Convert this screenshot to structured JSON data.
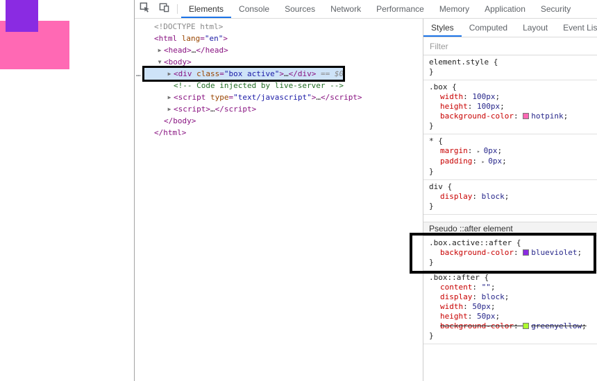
{
  "preview": {
    "hotpink": "#ff69b4",
    "blueviolet": "#8a2be2"
  },
  "toolbar": {
    "tabs": [
      "Elements",
      "Console",
      "Sources",
      "Network",
      "Performance",
      "Memory",
      "Application",
      "Security"
    ],
    "active_tab": "Elements"
  },
  "elements": {
    "more_indicator": "…",
    "lines": [
      {
        "indent": 0,
        "arrow": "",
        "segs": [
          [
            "doctype",
            "<!DOCTYPE html>"
          ]
        ]
      },
      {
        "indent": 0,
        "arrow": "",
        "segs": [
          [
            "tag",
            "<html "
          ],
          [
            "attr",
            "lang"
          ],
          [
            "tag",
            "="
          ],
          [
            "val",
            "\"en\""
          ],
          [
            "tag",
            ">"
          ]
        ]
      },
      {
        "indent": 1,
        "arrow": "▶",
        "segs": [
          [
            "tag",
            "<head>"
          ],
          [
            "ell",
            "…"
          ],
          [
            "tag",
            "</head>"
          ]
        ]
      },
      {
        "indent": 1,
        "arrow": "▼",
        "segs": [
          [
            "tag",
            "<body>"
          ]
        ]
      },
      {
        "indent": 2,
        "arrow": "▶",
        "selected": true,
        "segs": [
          [
            "tag",
            "<div "
          ],
          [
            "attr",
            "class"
          ],
          [
            "tag",
            "="
          ],
          [
            "val",
            "\"box active\""
          ],
          [
            "tag",
            ">"
          ],
          [
            "ell",
            "…"
          ],
          [
            "tag",
            "</div>"
          ],
          [
            "hint",
            " == $0"
          ]
        ]
      },
      {
        "indent": 2,
        "arrow": "",
        "segs": [
          [
            "comment",
            "<!-- Code injected by live-server -->"
          ]
        ]
      },
      {
        "indent": 2,
        "arrow": "▶",
        "segs": [
          [
            "tag",
            "<script "
          ],
          [
            "attr",
            "type"
          ],
          [
            "tag",
            "="
          ],
          [
            "val",
            "\"text/javascript\""
          ],
          [
            "tag",
            ">"
          ],
          [
            "ell",
            "…"
          ],
          [
            "tag",
            "</script>"
          ]
        ]
      },
      {
        "indent": 2,
        "arrow": "▶",
        "segs": [
          [
            "tag",
            "<script>"
          ],
          [
            "ell",
            "…"
          ],
          [
            "tag",
            "</script>"
          ]
        ]
      },
      {
        "indent": 1,
        "arrow": "",
        "segs": [
          [
            "tag",
            "</body>"
          ]
        ]
      },
      {
        "indent": 0,
        "arrow": "",
        "segs": [
          [
            "tag",
            "</html>"
          ]
        ]
      }
    ]
  },
  "styles": {
    "tabs": [
      "Styles",
      "Computed",
      "Layout",
      "Event Listeners"
    ],
    "active_tab": "Styles",
    "filter_placeholder": "Filter",
    "sections": [
      {
        "type": "rule",
        "selector": "element.style",
        "props": []
      },
      {
        "type": "rule",
        "selector": ".box",
        "props": [
          {
            "name": "width",
            "value": "100px"
          },
          {
            "name": "height",
            "value": "100px"
          },
          {
            "name": "background-color",
            "value": "hotpink",
            "swatch": "#ff69b4"
          }
        ]
      },
      {
        "type": "rule",
        "selector": "*",
        "props": [
          {
            "name": "margin",
            "value": "0px",
            "expand": true
          },
          {
            "name": "padding",
            "value": "0px",
            "expand": true
          }
        ]
      },
      {
        "type": "rule",
        "selector": "div",
        "props": [
          {
            "name": "display",
            "value": "block"
          }
        ]
      },
      {
        "type": "header",
        "label": "Pseudo ::after element"
      },
      {
        "type": "rule",
        "selector": ".box.active::after",
        "annotated": true,
        "props": [
          {
            "name": "background-color",
            "value": "blueviolet",
            "swatch": "#8a2be2"
          }
        ]
      },
      {
        "type": "rule",
        "selector": ".box::after",
        "props": [
          {
            "name": "content",
            "value": "\"\""
          },
          {
            "name": "display",
            "value": "block"
          },
          {
            "name": "width",
            "value": "50px"
          },
          {
            "name": "height",
            "value": "50px"
          },
          {
            "name": "background-color",
            "value": "greenyellow",
            "swatch": "#adff2f",
            "struck": true
          }
        ]
      }
    ]
  }
}
